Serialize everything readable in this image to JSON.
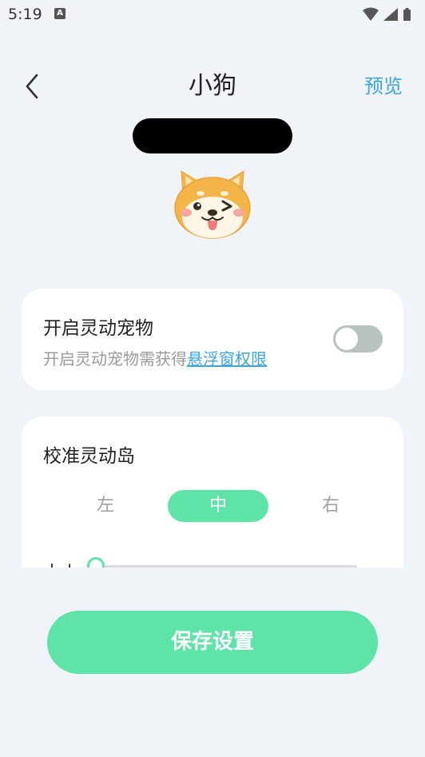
{
  "status_bar": {
    "time": "5:19",
    "notification_letter": "A"
  },
  "header": {
    "title": "小狗",
    "action": "预览"
  },
  "pet_card": {
    "title": "开启灵动宠物",
    "desc_prefix": "开启灵动宠物需获得",
    "desc_link": "悬浮窗权限",
    "toggle_on": false
  },
  "calibrate_card": {
    "title": "校准灵动岛",
    "positions": [
      "左",
      "中",
      "右"
    ],
    "selected": "中",
    "size_label": "大小",
    "size_value": 0
  },
  "save_button": "保存设置",
  "colors": {
    "accent": "#5de4a6",
    "link": "#3aa6e8",
    "background": "#f0f3f8"
  }
}
